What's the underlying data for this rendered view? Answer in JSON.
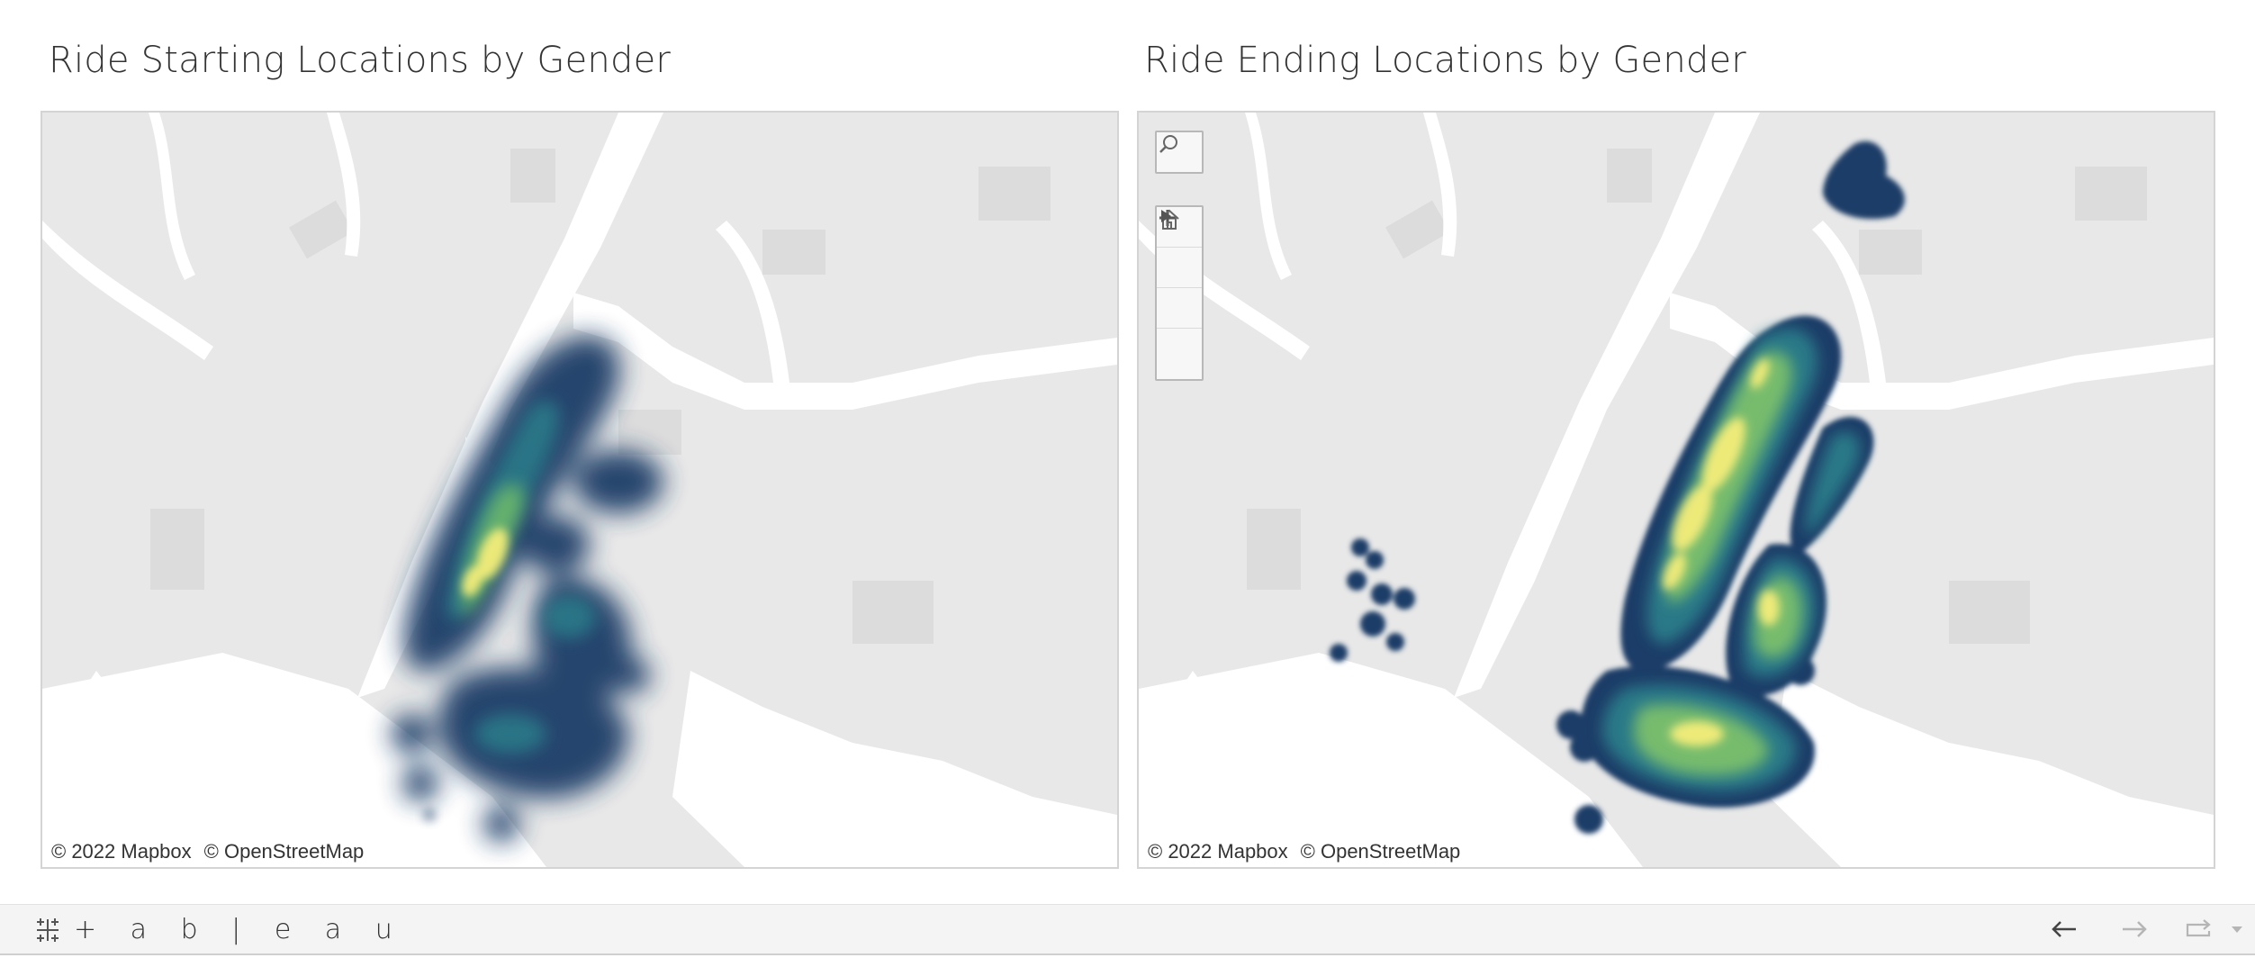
{
  "app": {
    "wordmark": "+ a b | e a u"
  },
  "sheets": [
    {
      "title": "Ride Starting Locations by Gender",
      "attribution": [
        "© 2022 Mapbox",
        "© OpenStreetMap"
      ]
    },
    {
      "title": "Ride Ending Locations by Gender",
      "attribution": [
        "© 2022 Mapbox",
        "© OpenStreetMap"
      ]
    }
  ],
  "map_tools": [
    {
      "name": "search-icon"
    },
    {
      "name": "zoom-in-icon"
    },
    {
      "name": "zoom-out-icon"
    },
    {
      "name": "home-icon"
    },
    {
      "name": "pan-arrow-icon"
    }
  ],
  "footer_nav": [
    {
      "name": "undo-arrow-icon"
    },
    {
      "name": "redo-arrow-icon"
    },
    {
      "name": "revert-icon"
    },
    {
      "name": "dropdown-caret-icon"
    }
  ],
  "colors": {
    "land": "#e8e8e8",
    "water": "#ffffff",
    "park": "#dedede",
    "density_low": "#1b3a66",
    "density_mid": "#2a7f8e",
    "density_high": "#7cc06c",
    "density_peak": "#fdf27a"
  }
}
